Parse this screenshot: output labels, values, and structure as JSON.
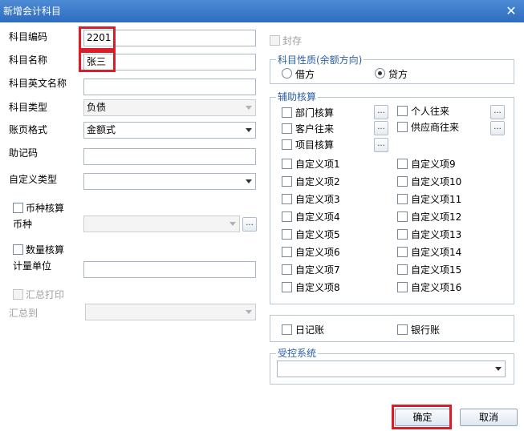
{
  "window": {
    "title": "新增会计科目"
  },
  "left": {
    "code_label": "科目编码",
    "code_value": "2201",
    "name_label": "科目名称",
    "name_value": "张三",
    "en_name_label": "科目英文名称",
    "en_name_value": "",
    "type_label": "科目类型",
    "type_value": "负债",
    "page_format_label": "账页格式",
    "page_format_value": "金额式",
    "mnemonic_label": "助记码",
    "mnemonic_value": "",
    "custom_type_label": "自定义类型",
    "custom_type_value": "",
    "currency_check_label": "币种核算",
    "currency_label": "币种",
    "currency_value": "",
    "quantity_check_label": "数量核算",
    "unit_label": "计量单位",
    "unit_value": "",
    "summary_print_label": "汇总打印",
    "summary_to_label": "汇总到",
    "summary_to_value": ""
  },
  "right": {
    "seal_label": "封存",
    "nature_title": "科目性质(余额方向)",
    "debit_label": "借方",
    "credit_label": "贷方",
    "aux_title": "辅助核算",
    "aux_dept": "部门核算",
    "aux_person": "个人往来",
    "aux_customer": "客户往来",
    "aux_supplier": "供应商往来",
    "aux_project": "项目核算",
    "custom_items_left": [
      "自定义项1",
      "自定义项2",
      "自定义项3",
      "自定义项4",
      "自定义项5",
      "自定义项6",
      "自定义项7",
      "自定义项8"
    ],
    "custom_items_right": [
      "自定义项9",
      "自定义项10",
      "自定义项11",
      "自定义项12",
      "自定义项13",
      "自定义项14",
      "自定义项15",
      "自定义项16"
    ],
    "journal_label": "日记账",
    "bank_label": "银行账",
    "controlled_title": "受控系统",
    "controlled_value": ""
  },
  "buttons": {
    "ok": "确定",
    "cancel": "取消"
  },
  "colors": {
    "title_bar": "#2e6cbf",
    "highlight": "#d81e28",
    "group_title": "#2b5ea8"
  }
}
